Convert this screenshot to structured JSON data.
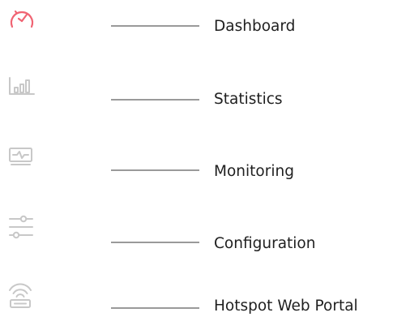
{
  "sidebar": {
    "items": [
      {
        "label": "Dashboard",
        "icon": "speedometer-icon",
        "color": "#f06473",
        "active": true
      },
      {
        "label": "Statistics",
        "icon": "bar-chart-icon",
        "color": "#c8c8c8",
        "active": false
      },
      {
        "label": "Monitoring",
        "icon": "monitor-pulse-icon",
        "color": "#c8c8c8",
        "active": false
      },
      {
        "label": "Configuration",
        "icon": "sliders-icon",
        "color": "#c8c8c8",
        "active": false
      },
      {
        "label": "Hotspot Web Portal",
        "icon": "wifi-router-icon",
        "color": "#c8c8c8",
        "active": false
      }
    ]
  }
}
